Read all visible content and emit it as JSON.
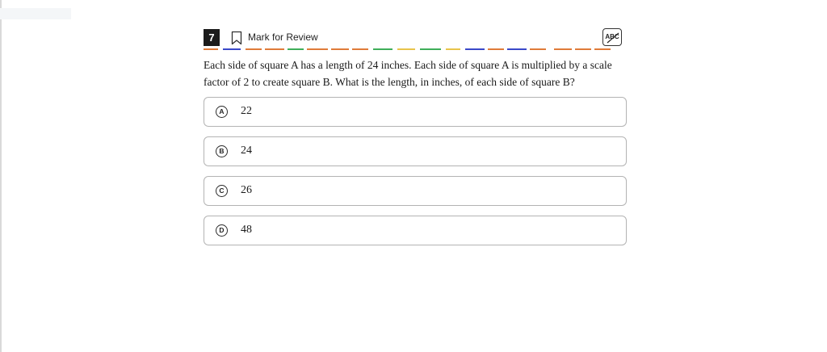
{
  "question": {
    "number": "7",
    "mark_for_review_label": "Mark for Review",
    "abc_tool_label": "ABC",
    "text": "Each side of square A has a length of 24 inches. Each side of square A is multiplied by a scale factor of 2 to create square B. What is the length, in inches, of each side of square B?"
  },
  "options": [
    {
      "letter": "A",
      "text": "22"
    },
    {
      "letter": "B",
      "text": "24"
    },
    {
      "letter": "C",
      "text": "26"
    },
    {
      "letter": "D",
      "text": "48"
    }
  ],
  "colors": {
    "dash_orange": "#e07b39",
    "dash_green": "#3fae5a",
    "dash_blue": "#3a48c9",
    "dash_yellow": "#e8c44a",
    "option_border": "#b3b3b3"
  },
  "icons": {
    "bookmark": "bookmark-icon",
    "abc": "abc-strikethrough-icon"
  }
}
